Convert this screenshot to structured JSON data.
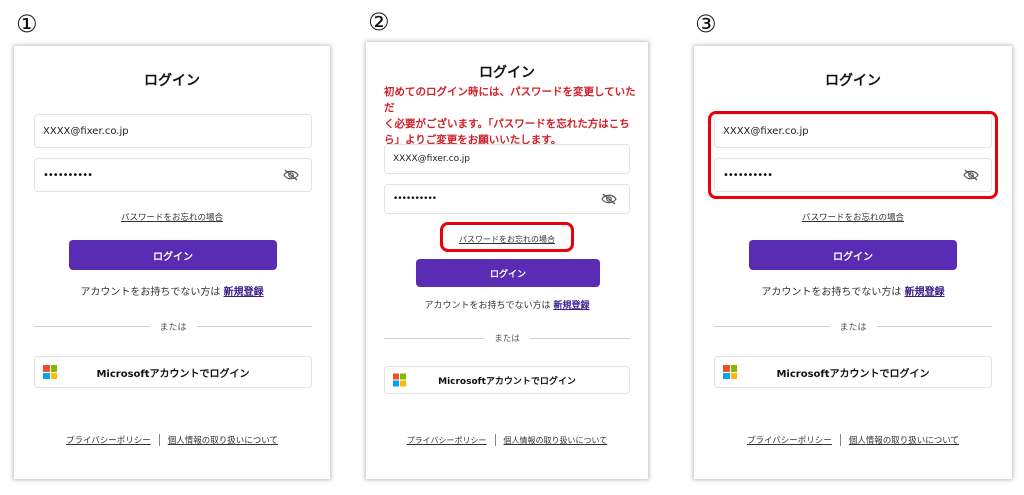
{
  "steps": [
    "①",
    "②",
    "③"
  ],
  "login": {
    "title": "ログイン",
    "email_value": "XXXX@fixer.co.jp",
    "password_value": "••••••••••",
    "forgot_link": "パスワードをお忘れの場合",
    "login_button": "ログイン",
    "no_account_text": "アカウントをお持ちでない方は",
    "signup_link": "新規登録",
    "divider_text": "または",
    "microsoft_button": "Microsoftアカウントでログイン",
    "privacy_link": "プライバシーポリシー",
    "personal_info_link": "個人情報の取り扱いについて"
  },
  "notice_lines": [
    "初めてのログイン時には、パスワードを変更していただ",
    "く必要がございます。「パスワードを忘れた方はこち",
    "ら」よりご変更をお願いいたします。"
  ],
  "colors": {
    "primary_button": "#5a2bb3",
    "notice_text": "#d0202a",
    "highlight_border": "#e8000b"
  },
  "icons": {
    "password_toggle": "eye-off-icon",
    "microsoft": "microsoft-logo-icon"
  }
}
